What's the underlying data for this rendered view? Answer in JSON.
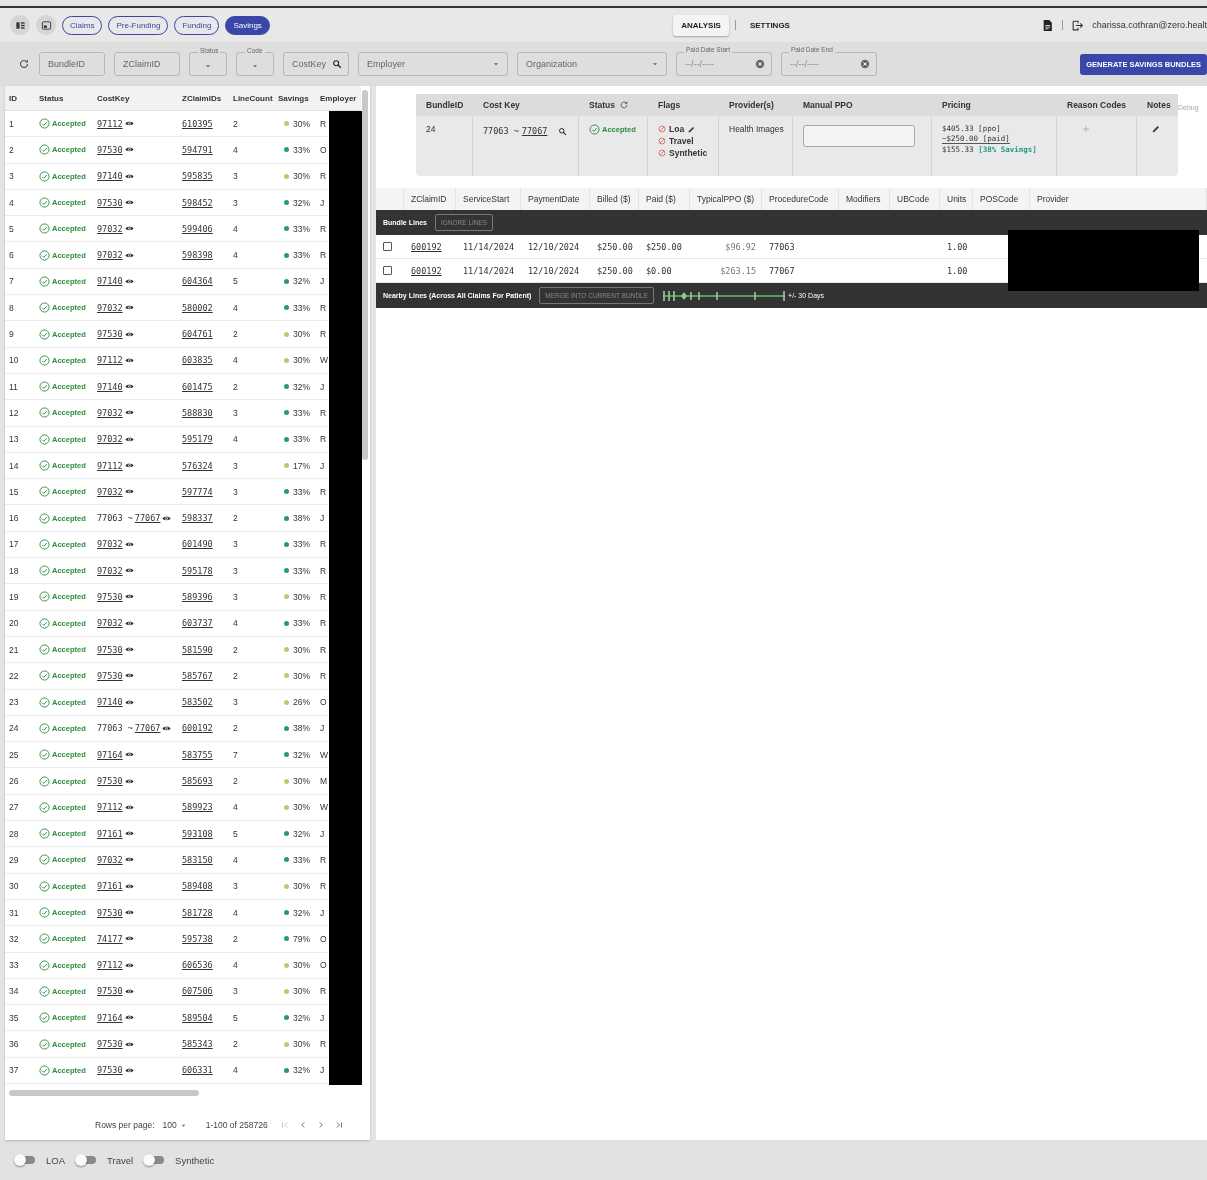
{
  "tabs": [
    {
      "label": "Claims",
      "selected": false
    },
    {
      "label": "Pre-Funding",
      "selected": false
    },
    {
      "label": "Funding",
      "selected": false
    },
    {
      "label": "Savings",
      "selected": true
    }
  ],
  "nav": [
    {
      "label": "ANALYSIS",
      "selected": true
    },
    {
      "label": "SETTINGS",
      "selected": false
    }
  ],
  "user_email": "charissa.cothran@zero.healt",
  "filters": [
    {
      "kind": "text",
      "placeholder": "BundleID"
    },
    {
      "kind": "text",
      "placeholder": "ZClaimID"
    },
    {
      "kind": "select",
      "label": "Status"
    },
    {
      "kind": "select",
      "label": "Code"
    },
    {
      "kind": "search",
      "placeholder": "CostKey"
    },
    {
      "kind": "dropdown",
      "placeholder": "Employer"
    },
    {
      "kind": "dropdown",
      "placeholder": "Organization"
    },
    {
      "kind": "date",
      "label": "Paid Date Start",
      "value": "--/--/----"
    },
    {
      "kind": "date",
      "label": "Paid Date End",
      "value": "--/--/----"
    }
  ],
  "generate_button": "GENERATE SAVINGS BUNDLES",
  "bundles": {
    "columns": [
      "ID",
      "Status",
      "CostKey",
      "ZClaimIDs",
      "LineCount",
      "Savings",
      "Employer"
    ],
    "rows": [
      {
        "id": "1",
        "status": "Accepted",
        "cost_key": "97112",
        "claim_ids": "610395",
        "line_count": "2",
        "savings": "30%",
        "color": "#c8c46e",
        "employer": "R"
      },
      {
        "id": "2",
        "status": "Accepted",
        "cost_key": "97530",
        "claim_ids": "594791",
        "line_count": "4",
        "savings": "33%",
        "color": "#279a6e",
        "employer": "O"
      },
      {
        "id": "3",
        "status": "Accepted",
        "cost_key": "97140",
        "claim_ids": "595835",
        "line_count": "3",
        "savings": "30%",
        "color": "#c8c46e",
        "employer": "R"
      },
      {
        "id": "4",
        "status": "Accepted",
        "cost_key": "97530",
        "claim_ids": "598452",
        "line_count": "3",
        "savings": "32%",
        "color": "#279a6e",
        "employer": "J"
      },
      {
        "id": "5",
        "status": "Accepted",
        "cost_key": "97032",
        "claim_ids": "599406",
        "line_count": "4",
        "savings": "33%",
        "color": "#279a6e",
        "employer": "R"
      },
      {
        "id": "6",
        "status": "Accepted",
        "cost_key": "97032",
        "claim_ids": "598398",
        "line_count": "4",
        "savings": "33%",
        "color": "#279a6e",
        "employer": "R"
      },
      {
        "id": "7",
        "status": "Accepted",
        "cost_key": "97140",
        "claim_ids": "604364",
        "line_count": "5",
        "savings": "32%",
        "color": "#279a6e",
        "employer": "J"
      },
      {
        "id": "8",
        "status": "Accepted",
        "cost_key": "97032",
        "claim_ids": "580002",
        "line_count": "4",
        "savings": "33%",
        "color": "#279a6e",
        "employer": "R"
      },
      {
        "id": "9",
        "status": "Accepted",
        "cost_key": "97530",
        "claim_ids": "604761",
        "line_count": "2",
        "savings": "30%",
        "color": "#c8c46e",
        "employer": "R"
      },
      {
        "id": "10",
        "status": "Accepted",
        "cost_key": "97112",
        "claim_ids": "603835",
        "line_count": "4",
        "savings": "30%",
        "color": "#c8c46e",
        "employer": "W"
      },
      {
        "id": "11",
        "status": "Accepted",
        "cost_key": "97140",
        "claim_ids": "601475",
        "line_count": "2",
        "savings": "32%",
        "color": "#279a6e",
        "employer": "J"
      },
      {
        "id": "12",
        "status": "Accepted",
        "cost_key": "97032",
        "claim_ids": "588830",
        "line_count": "3",
        "savings": "33%",
        "color": "#279a6e",
        "employer": "R"
      },
      {
        "id": "13",
        "status": "Accepted",
        "cost_key": "97032",
        "claim_ids": "595179",
        "line_count": "4",
        "savings": "33%",
        "color": "#279a6e",
        "employer": "R"
      },
      {
        "id": "14",
        "status": "Accepted",
        "cost_key": "97112",
        "claim_ids": "576324",
        "line_count": "3",
        "savings": "17%",
        "color": "#c8c46e",
        "employer": "J"
      },
      {
        "id": "15",
        "status": "Accepted",
        "cost_key": "97032",
        "claim_ids": "597774",
        "line_count": "3",
        "savings": "33%",
        "color": "#279a6e",
        "employer": "R"
      },
      {
        "id": "16",
        "status": "Accepted",
        "cost_key_from": "77063 ~",
        "cost_key": "77067",
        "claim_ids": "598337",
        "line_count": "2",
        "savings": "38%",
        "color": "#279a6e",
        "employer": "J"
      },
      {
        "id": "17",
        "status": "Accepted",
        "cost_key": "97032",
        "claim_ids": "601490",
        "line_count": "3",
        "savings": "33%",
        "color": "#279a6e",
        "employer": "R"
      },
      {
        "id": "18",
        "status": "Accepted",
        "cost_key": "97032",
        "claim_ids": "595178",
        "line_count": "3",
        "savings": "33%",
        "color": "#279a6e",
        "employer": "R"
      },
      {
        "id": "19",
        "status": "Accepted",
        "cost_key": "97530",
        "claim_ids": "589396",
        "line_count": "3",
        "savings": "30%",
        "color": "#c8c46e",
        "employer": "R"
      },
      {
        "id": "20",
        "status": "Accepted",
        "cost_key": "97032",
        "claim_ids": "603737",
        "line_count": "4",
        "savings": "33%",
        "color": "#279a6e",
        "employer": "R"
      },
      {
        "id": "21",
        "status": "Accepted",
        "cost_key": "97530",
        "claim_ids": "581590",
        "line_count": "2",
        "savings": "30%",
        "color": "#c8c46e",
        "employer": "R"
      },
      {
        "id": "22",
        "status": "Accepted",
        "cost_key": "97530",
        "claim_ids": "585767",
        "line_count": "2",
        "savings": "30%",
        "color": "#c8c46e",
        "employer": "R"
      },
      {
        "id": "23",
        "status": "Accepted",
        "cost_key": "97140",
        "claim_ids": "583502",
        "line_count": "3",
        "savings": "26%",
        "color": "#c8c46e",
        "employer": "O"
      },
      {
        "id": "24",
        "status": "Accepted",
        "cost_key_from": "77063 ~",
        "cost_key": "77067",
        "claim_ids": "600192",
        "line_count": "2",
        "savings": "38%",
        "color": "#279a6e",
        "employer": "J"
      },
      {
        "id": "25",
        "status": "Accepted",
        "cost_key": "97164",
        "claim_ids": "583755",
        "line_count": "7",
        "savings": "32%",
        "color": "#279a6e",
        "employer": "W"
      },
      {
        "id": "26",
        "status": "Accepted",
        "cost_key": "97530",
        "claim_ids": "585693",
        "line_count": "2",
        "savings": "30%",
        "color": "#c8c46e",
        "employer": "M"
      },
      {
        "id": "27",
        "status": "Accepted",
        "cost_key": "97112",
        "claim_ids": "589923",
        "line_count": "4",
        "savings": "30%",
        "color": "#c8c46e",
        "employer": "W"
      },
      {
        "id": "28",
        "status": "Accepted",
        "cost_key": "97161",
        "claim_ids": "593108",
        "line_count": "5",
        "savings": "32%",
        "color": "#279a6e",
        "employer": "J"
      },
      {
        "id": "29",
        "status": "Accepted",
        "cost_key": "97032",
        "claim_ids": "583150",
        "line_count": "4",
        "savings": "33%",
        "color": "#279a6e",
        "employer": "R"
      },
      {
        "id": "30",
        "status": "Accepted",
        "cost_key": "97161",
        "claim_ids": "589408",
        "line_count": "3",
        "savings": "30%",
        "color": "#c8c46e",
        "employer": "R"
      },
      {
        "id": "31",
        "status": "Accepted",
        "cost_key": "97530",
        "claim_ids": "581728",
        "line_count": "4",
        "savings": "32%",
        "color": "#279a6e",
        "employer": "J"
      },
      {
        "id": "32",
        "status": "Accepted",
        "cost_key": "74177",
        "claim_ids": "595738",
        "line_count": "2",
        "savings": "79%",
        "color": "#279a6e",
        "employer": "O"
      },
      {
        "id": "33",
        "status": "Accepted",
        "cost_key": "97112",
        "claim_ids": "606536",
        "line_count": "4",
        "savings": "30%",
        "color": "#c8c46e",
        "employer": "O"
      },
      {
        "id": "34",
        "status": "Accepted",
        "cost_key": "97530",
        "claim_ids": "607506",
        "line_count": "3",
        "savings": "30%",
        "color": "#c8c46e",
        "employer": "R"
      },
      {
        "id": "35",
        "status": "Accepted",
        "cost_key": "97164",
        "claim_ids": "589504",
        "line_count": "5",
        "savings": "32%",
        "color": "#279a6e",
        "employer": "J"
      },
      {
        "id": "36",
        "status": "Accepted",
        "cost_key": "97530",
        "claim_ids": "585343",
        "line_count": "2",
        "savings": "30%",
        "color": "#c8c46e",
        "employer": "R"
      },
      {
        "id": "37",
        "status": "Accepted",
        "cost_key": "97530",
        "claim_ids": "606331",
        "line_count": "4",
        "savings": "32%",
        "color": "#279a6e",
        "employer": "J"
      }
    ],
    "rows_per_page_label": "Rows per page:",
    "rows_per_page": "100",
    "range": "1-100 of 258726"
  },
  "detail": {
    "summary_columns": [
      "BundleID",
      "Cost Key",
      "Status",
      "Flags",
      "Provider(s)",
      "Manual PPO",
      "Pricing",
      "Reason Codes",
      "Notes"
    ],
    "debug_label": "Debug",
    "bundle": {
      "bundle_id": "24",
      "cost_key_from": "77063 ~",
      "cost_key": "77067",
      "status": "Accepted",
      "flags": [
        {
          "label": "Loa",
          "on": false,
          "editable": true
        },
        {
          "label": "Travel",
          "on": false,
          "editable": false
        },
        {
          "label": "Synthetic",
          "on": false,
          "editable": false
        }
      ],
      "provider": "Health Images",
      "pricing": {
        "ppo": "$405.33",
        "ppo_tag": "[ppo]",
        "paid": "−$250.00",
        "paid_tag": "[paid]",
        "net": "$155.33",
        "savings_tag": "[38% Savings]"
      }
    },
    "line_columns": [
      "ZClaimID",
      "ServiceStart",
      "PaymentDate",
      "Billed ($)",
      "Paid ($)",
      "TypicalPPO ($)",
      "ProcedureCode",
      "Modifiers",
      "UBCode",
      "Units",
      "POSCode",
      "Provider"
    ],
    "bundle_lines_label": "Bundle Lines",
    "ignore_button": {
      "label": "IGNORE LINES",
      "disabled": true
    },
    "lines": [
      {
        "checked": false,
        "claim_id": "600192",
        "service_start": "11/14/2024",
        "payment_date": "12/10/2024",
        "billed": "$250.00",
        "paid": "$250.00",
        "typical_ppo": "$96.92",
        "procedure_code": "77063",
        "units": "1.00"
      },
      {
        "checked": false,
        "claim_id": "600192",
        "service_start": "11/14/2024",
        "payment_date": "12/10/2024",
        "billed": "$250.00",
        "paid": "$0.00",
        "typical_ppo": "$263.15",
        "procedure_code": "77067",
        "units": "1.00"
      }
    ],
    "nearby_label": "Nearby Lines (Across All Claims For Patient)",
    "merge_button": {
      "label": "MERGE INTO CURRENT BUNDLE",
      "disabled": true
    },
    "range_label": "+/- 30 Days"
  },
  "toggles": [
    {
      "label": "LOA",
      "on": false
    },
    {
      "label": "Travel",
      "on": false
    },
    {
      "label": "Synthetic",
      "on": false
    }
  ]
}
